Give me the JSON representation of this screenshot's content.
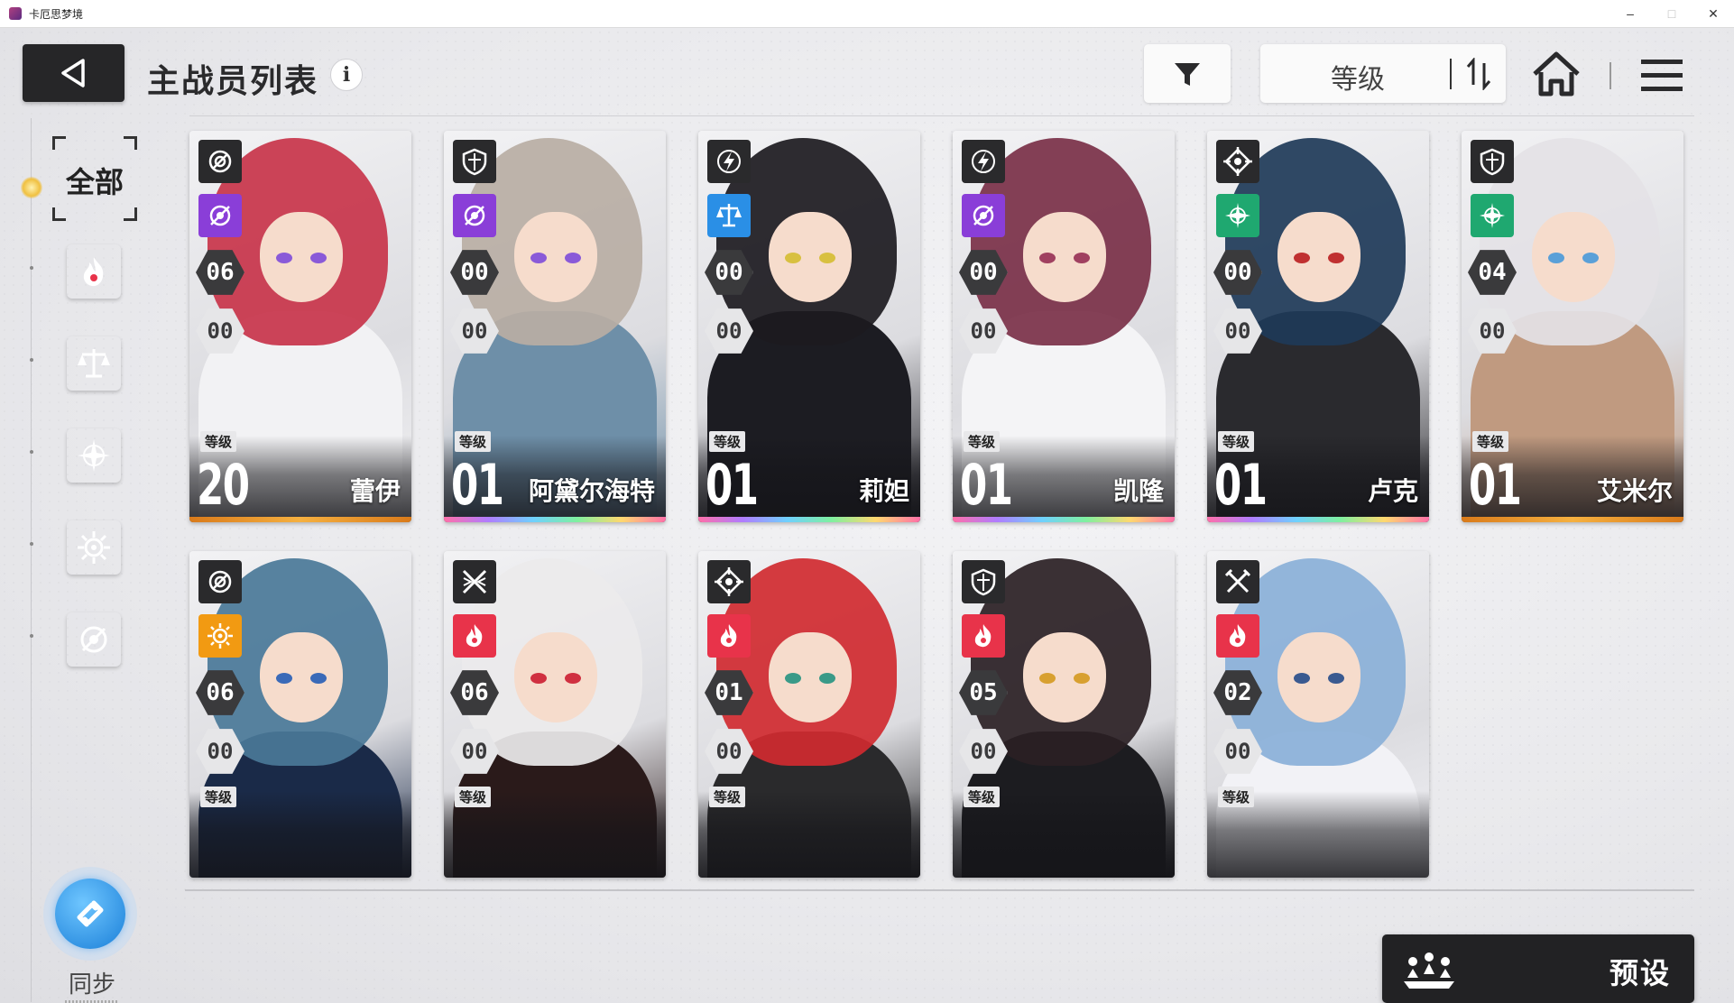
{
  "window": {
    "title": "卡厄思梦境",
    "controls": [
      "–",
      "□",
      "✕"
    ]
  },
  "header": {
    "title": "主战员列表",
    "info_glyph": "i",
    "sort_label": "等级"
  },
  "sidebar": {
    "all_label": "全部",
    "categories": [
      {
        "name": "passion",
        "color": "#e8334a",
        "icon": "flame-icon"
      },
      {
        "name": "justice",
        "color": "#2a8fe6",
        "icon": "scale-icon"
      },
      {
        "name": "order",
        "color": "#1fa870",
        "icon": "star-cross-icon"
      },
      {
        "name": "instinct",
        "color": "#f29a12",
        "icon": "sun-icon"
      },
      {
        "name": "void",
        "color": "#8a3ed8",
        "icon": "swirl-icon"
      }
    ],
    "sync_label": "同步"
  },
  "footer": {
    "preset_label": "预设"
  },
  "cards": [
    {
      "name": "蕾伊",
      "level_tag": "等级",
      "level": "20",
      "stat_a": "06",
      "stat_b": "00",
      "class_icon": "target-icon",
      "element": "void",
      "element_color": "#8a3ed8",
      "rarity": "gold",
      "hair": "#c8344a",
      "eye": "#8a5ad8",
      "outfit": "#f2f2f4"
    },
    {
      "name": "阿黛尔海特",
      "level_tag": "等级",
      "level": "01",
      "stat_a": "00",
      "stat_b": "00",
      "class_icon": "shield-icon",
      "element": "void",
      "element_color": "#8a3ed8",
      "rarity": "rainbow",
      "hair": "#b9aea4",
      "eye": "#8a5ad8",
      "outfit": "#6e8fa8"
    },
    {
      "name": "莉妲",
      "level_tag": "等级",
      "level": "01",
      "stat_a": "00",
      "stat_b": "00",
      "class_icon": "lightning-icon",
      "element": "justice",
      "element_color": "#2a8fe6",
      "rarity": "rainbow",
      "hair": "#1c1a20",
      "eye": "#d8c040",
      "outfit": "#1c1c22"
    },
    {
      "name": "凯隆",
      "level_tag": "等级",
      "level": "01",
      "stat_a": "00",
      "stat_b": "00",
      "class_icon": "lightning-icon",
      "element": "void",
      "element_color": "#8a3ed8",
      "rarity": "rainbow",
      "hair": "#7a3048",
      "eye": "#a04060",
      "outfit": "#f4f4f6"
    },
    {
      "name": "卢克",
      "level_tag": "等级",
      "level": "01",
      "stat_a": "00",
      "stat_b": "00",
      "class_icon": "crosshair-icon",
      "element": "order",
      "element_color": "#1fa870",
      "rarity": "rainbow",
      "hair": "#1e3a58",
      "eye": "#c03030",
      "outfit": "#2a2a2e"
    },
    {
      "name": "艾米尔",
      "level_tag": "等级",
      "level": "01",
      "stat_a": "04",
      "stat_b": "00",
      "class_icon": "shield-icon",
      "element": "order",
      "element_color": "#1fa870",
      "rarity": "gold",
      "hair": "#e4e2e6",
      "eye": "#5aa0d8",
      "outfit": "#c09a80"
    },
    {
      "name": "",
      "level_tag": "等级",
      "level": "",
      "stat_a": "06",
      "stat_b": "00",
      "class_icon": "target-icon",
      "element": "instinct",
      "element_color": "#f29a12",
      "rarity": "none",
      "hair": "#4a7898",
      "eye": "#3a6ab8",
      "outfit": "#1a2a48"
    },
    {
      "name": "",
      "level_tag": "等级",
      "level": "",
      "stat_a": "06",
      "stat_b": "00",
      "class_icon": "blades-icon",
      "element": "passion",
      "element_color": "#e8334a",
      "rarity": "none",
      "hair": "#eceaec",
      "eye": "#d03040",
      "outfit": "#2a1a1a"
    },
    {
      "name": "",
      "level_tag": "等级",
      "level": "",
      "stat_a": "01",
      "stat_b": "00",
      "class_icon": "crosshair-icon",
      "element": "passion",
      "element_color": "#e8334a",
      "rarity": "none",
      "hair": "#d02a30",
      "eye": "#3a9a88",
      "outfit": "#2a2a2c"
    },
    {
      "name": "",
      "level_tag": "等级",
      "level": "",
      "stat_a": "05",
      "stat_b": "00",
      "class_icon": "shield-icon",
      "element": "passion",
      "element_color": "#e8334a",
      "rarity": "none",
      "hair": "#2a2024",
      "eye": "#d8a030",
      "outfit": "#1c1c20"
    },
    {
      "name": "",
      "level_tag": "等级",
      "level": "",
      "stat_a": "02",
      "stat_b": "00",
      "class_icon": "swords-icon",
      "element": "passion",
      "element_color": "#e8334a",
      "rarity": "none",
      "hair": "#8ab0d8",
      "eye": "#3a5a90",
      "outfit": "#f2f2f6"
    }
  ]
}
